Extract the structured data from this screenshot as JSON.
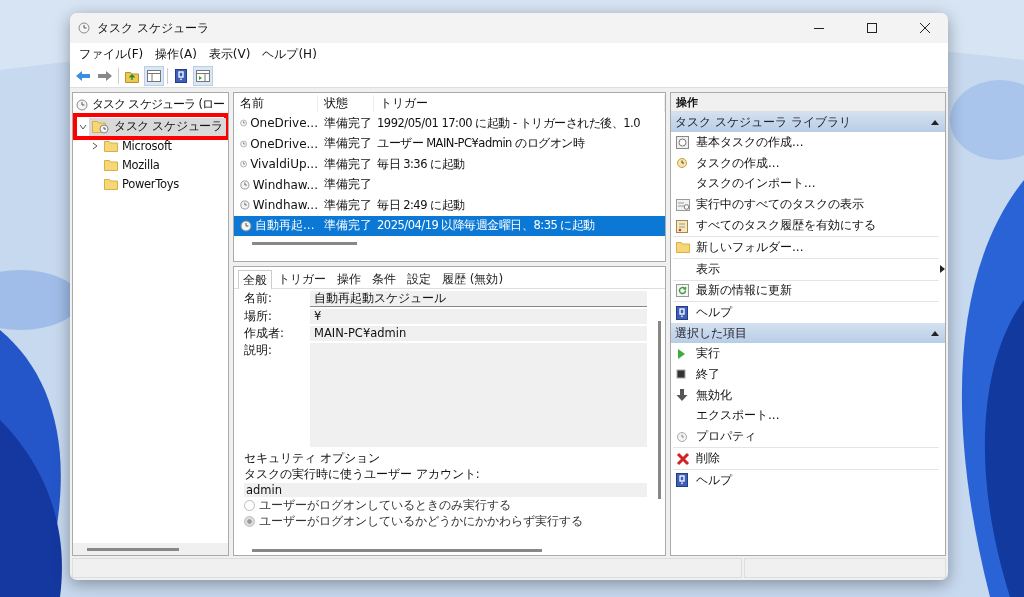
{
  "window": {
    "title": "タスク スケジューラ"
  },
  "menu": [
    "ファイル(F)",
    "操作(A)",
    "表示(V)",
    "ヘルプ(H)"
  ],
  "tree": [
    {
      "label": "タスク スケジューラ (ロー",
      "selected": false,
      "highlighted": false,
      "children": [
        {
          "label": "タスク スケジューラ",
          "expanded": true,
          "selected": true,
          "highlighted": true,
          "children": [
            {
              "label": "Microsoft",
              "expanded": false,
              "selected": false,
              "highlighted": false
            },
            {
              "label": "Mozilla",
              "selected": false,
              "highlighted": false
            },
            {
              "label": "PowerToys",
              "selected": false,
              "highlighted": false
            }
          ]
        }
      ]
    }
  ],
  "task_table": {
    "columns": [
      "名前",
      "状態",
      "トリガー"
    ],
    "rows": [
      {
        "name": "OneDrive...",
        "status": "準備完了",
        "trigger": "1992/05/01 17:00 に起動 - トリガーされた後、1.0",
        "selected": false
      },
      {
        "name": "OneDrive...",
        "status": "準備完了",
        "trigger": "ユーザー MAIN-PC¥admin のログオン時",
        "selected": false
      },
      {
        "name": "VivaldiUp...",
        "status": "準備完了",
        "trigger": "毎日 3:36 に起動",
        "selected": false
      },
      {
        "name": "Windhaw...",
        "status": "準備完了",
        "selected": false
      },
      {
        "name": "Windhaw...",
        "status": "準備完了",
        "trigger": "毎日 2:49 に起動",
        "selected": false
      },
      {
        "name": "自動再起...",
        "status": "準備完了",
        "trigger": "2025/04/19 以降毎週金曜日、8:35 に起動",
        "selected": true
      }
    ]
  },
  "details": {
    "tabs": [
      {
        "label": "全般",
        "selected": true
      },
      {
        "label": "トリガー",
        "selected": false
      },
      {
        "label": "操作",
        "selected": false
      },
      {
        "label": "条件",
        "selected": false
      },
      {
        "label": "設定",
        "selected": false
      },
      {
        "label": "履歴 (無効)",
        "selected": false
      }
    ],
    "fields": [
      {
        "label": "名前:",
        "value": "自動再起動スケジュール"
      },
      {
        "label": "場所:",
        "value": "¥"
      },
      {
        "label": "作成者:",
        "value": "MAIN-PC¥admin"
      },
      {
        "label": "説明:"
      }
    ],
    "security": {
      "title": "セキュリティ オプション",
      "account_label": "タスクの実行時に使うユーザー アカウント:",
      "account": "admin",
      "options": [
        {
          "label": "ユーザーがログオンしているときのみ実行する",
          "selected": false
        },
        {
          "label": "ユーザーがログオンしているかどうかにかかわらず実行する",
          "selected": true
        }
      ]
    }
  },
  "actions": {
    "title": "操作",
    "sections": [
      {
        "title": "タスク スケジューラ ライブラリ",
        "expanded": true,
        "items": [
          {
            "label": "基本タスクの作成...",
            "submenu": false
          },
          {
            "label": "タスクの作成...",
            "submenu": false
          },
          {
            "label": "タスクのインポート...",
            "submenu": false
          },
          {
            "label": "実行中のすべてのタスクの表示",
            "submenu": false
          },
          {
            "label": "すべてのタスク履歴を有効にする",
            "submenu": false
          },
          {
            "label": "新しいフォルダー...",
            "submenu": false
          },
          {
            "label": "表示",
            "submenu": true
          },
          {
            "label": "最新の情報に更新",
            "submenu": false
          },
          {
            "label": "ヘルプ",
            "submenu": false
          }
        ]
      },
      {
        "title": "選択した項目",
        "expanded": true,
        "items": [
          {
            "label": "実行",
            "submenu": false
          },
          {
            "label": "終了",
            "submenu": false
          },
          {
            "label": "無効化",
            "submenu": false
          },
          {
            "label": "エクスポート...",
            "submenu": false
          },
          {
            "label": "プロパティ",
            "submenu": false
          },
          {
            "label": "削除",
            "submenu": false
          },
          {
            "label": "ヘルプ",
            "submenu": false
          }
        ]
      }
    ]
  }
}
